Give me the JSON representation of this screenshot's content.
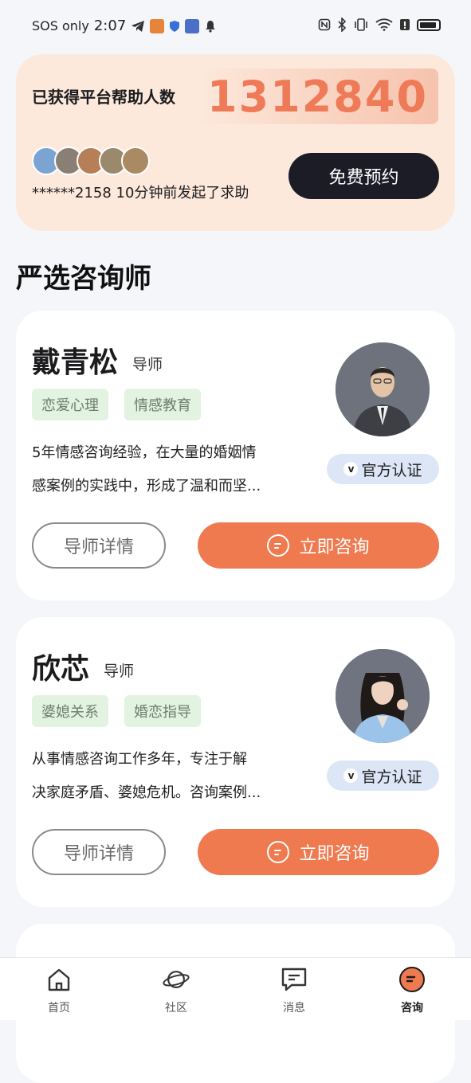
{
  "status_bar": {
    "carrier": "SOS only",
    "time": "2:07"
  },
  "banner": {
    "label": "已获得平台帮助人数",
    "count": "1312840",
    "notice": "******2158 10分钟前发起了求助",
    "button": "免费预约",
    "avatar_colors": [
      "#7ba4d2",
      "#8a7f74",
      "#b77f58",
      "#9a8a6b",
      "#a98a63"
    ]
  },
  "section_title": "严选咨询师",
  "counselors": [
    {
      "name": "戴青松",
      "role": "导师",
      "tags": [
        "恋爱心理",
        "情感教育"
      ],
      "desc_line1": "5年情感咨询经验，在大量的婚姻情",
      "desc_line2": "感案例的实践中，形成了温和而坚...",
      "cert": "官方认证",
      "cert_mark": "v",
      "detail_button": "导师详情",
      "consult_button": "立即咨询"
    },
    {
      "name": "欣芯",
      "role": "导师",
      "tags": [
        "婆媳关系",
        "婚恋指导"
      ],
      "desc_line1": "从事情感咨询工作多年，专注于解",
      "desc_line2": "决家庭矛盾、婆媳危机。咨询案例...",
      "cert": "官方认证",
      "cert_mark": "v",
      "detail_button": "导师详情",
      "consult_button": "立即咨询"
    }
  ],
  "nav": {
    "items": [
      {
        "label": "首页",
        "icon": "home-icon"
      },
      {
        "label": "社区",
        "icon": "planet-icon"
      },
      {
        "label": "消息",
        "icon": "message-icon"
      },
      {
        "label": "咨询",
        "icon": "consult-icon",
        "active": true
      }
    ]
  },
  "colors": {
    "accent": "#ef7a50",
    "banner_bg": "#fde9dc",
    "tag_bg": "#e2f3e2",
    "cert_bg": "#dce6f7",
    "dark_button": "#1c1c27"
  }
}
